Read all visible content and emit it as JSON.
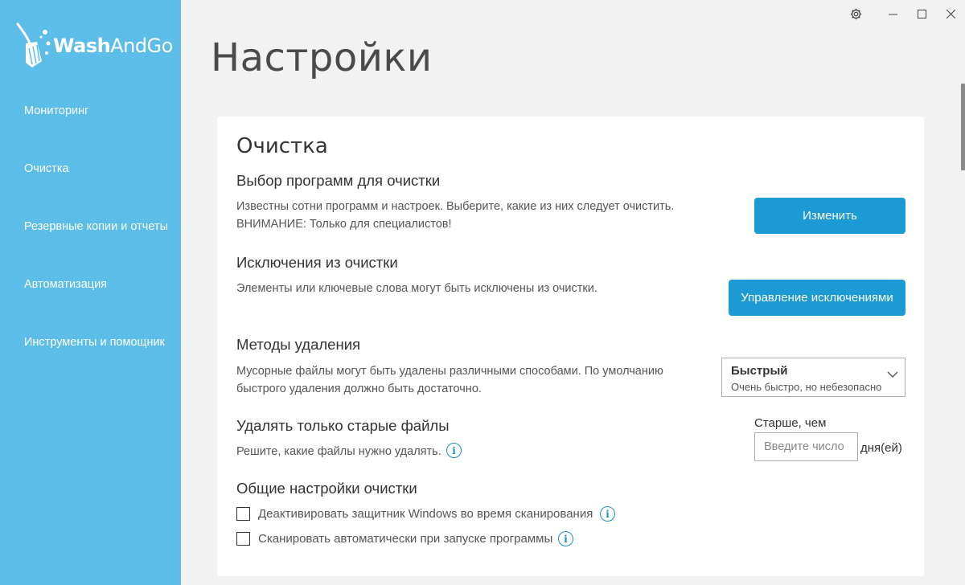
{
  "app": {
    "logo_text_bold": "Wash",
    "logo_text_rest": "AndGo",
    "accent_color": "#5bbde8",
    "button_color": "#1b9ad6"
  },
  "sidebar": {
    "items": [
      {
        "label": "Мониторинг"
      },
      {
        "label": "Очистка"
      },
      {
        "label": "Резервные копии и отчеты"
      },
      {
        "label": "Автоматизация"
      },
      {
        "label": "Инструменты и помощник"
      }
    ]
  },
  "window_controls": {
    "icons": [
      "gear-icon",
      "minimize-icon",
      "maximize-icon",
      "close-icon"
    ]
  },
  "page": {
    "title": "Настройки"
  },
  "card": {
    "title": "Очистка",
    "program_selection": {
      "title": "Выбор программ для очистки",
      "desc_line1": "Известны сотни программ и настроек. Выберите, какие из них следует очистить.",
      "desc_line2": "ВНИМАНИЕ: Только для специалистов!",
      "button": "Изменить"
    },
    "exclusions": {
      "title": "Исключения из очистки",
      "desc": "Элементы или ключевые слова могут быть исключены из очистки.",
      "button": "Управление исключениями"
    },
    "deletion_methods": {
      "title": "Методы удаления",
      "desc_line1": "Мусорные файлы могут быть удалены различными способами. По умолчанию",
      "desc_line2": "быстрого удаления должно быть достаточно.",
      "selected_value": "Быстрый",
      "selected_sub": "Очень быстро, но небезопасно"
    },
    "old_files": {
      "title": "Удалять только старые файлы",
      "desc": "Решите, какие файлы нужно удалять.",
      "older_label": "Старше, чем",
      "input_placeholder": "Введите число",
      "input_value": "",
      "unit": "дня(ей)"
    },
    "general": {
      "title": "Общие настройки очистки",
      "checkboxes": [
        {
          "label": "Деактивировать защитник Windows во время сканирования",
          "checked": false
        },
        {
          "label": "Сканировать автоматически при запуске программы",
          "checked": false
        }
      ]
    }
  }
}
